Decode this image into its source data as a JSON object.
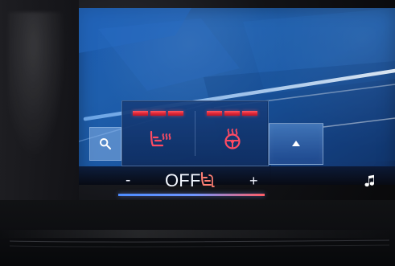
{
  "popup": {
    "controls": [
      {
        "icon": "seat-heat-icon",
        "level_segments": 3
      },
      {
        "icon": "steering-wheel-heat-icon",
        "level_segments": 3
      }
    ]
  },
  "search": {
    "icon": "search-icon"
  },
  "expand": {
    "icon": "chevron-up-icon"
  },
  "climate_bar": {
    "minus": "-",
    "status": "OFF",
    "plus": "+",
    "seat_icon": "seat-heat-icon",
    "status_line_colors": [
      "#4d8cff",
      "#6f95ff",
      "#ff5d65"
    ]
  },
  "media": {
    "icon": "music-note-icon"
  },
  "colors": {
    "accent_red": "#e52b3b",
    "accent_blue": "#4d8cff"
  }
}
